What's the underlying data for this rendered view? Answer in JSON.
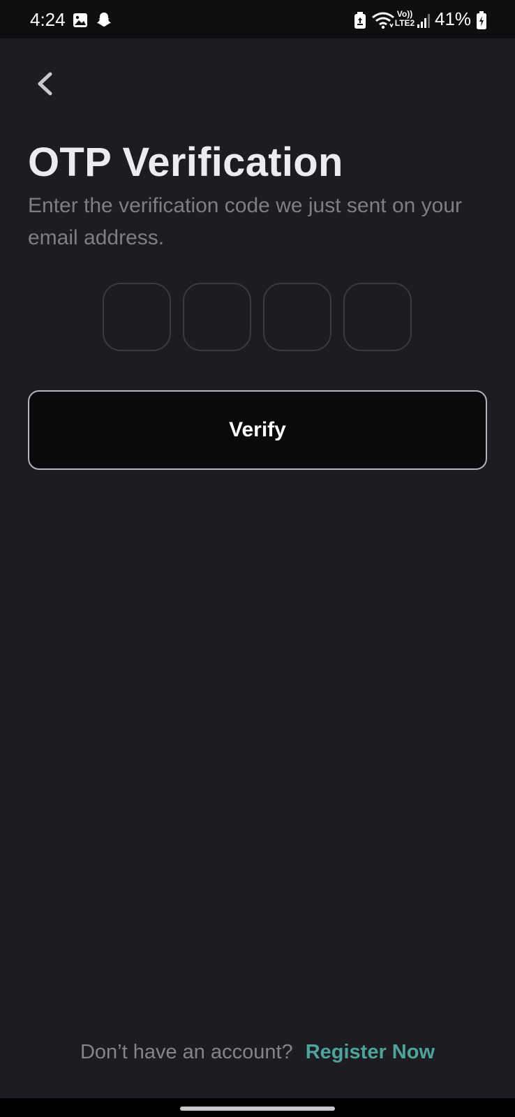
{
  "status_bar": {
    "time": "4:24",
    "network_label_top": "Vo))",
    "network_label_bottom": "LTE2",
    "battery_percent": "41%",
    "icons": [
      "gallery-icon",
      "snapchat-icon",
      "recycle-battery-icon",
      "wifi-icon",
      "signal-icon",
      "battery-icon"
    ]
  },
  "header": {
    "back_icon": "chevron-left-icon",
    "title": "OTP Verification",
    "subtitle": "Enter the verification code we just sent on your email address."
  },
  "otp": {
    "digits": [
      "",
      "",
      "",
      ""
    ]
  },
  "actions": {
    "verify_label": "Verify"
  },
  "footer": {
    "prompt": "Don’t have an account?",
    "link_label": "Register Now"
  },
  "colors": {
    "background": "#1d1c21",
    "status_bar": "#0f0f12",
    "title": "#ecebf0",
    "subtitle": "#7f7e84",
    "otp_border": "#3b3a40",
    "button_bg": "#0a0a0d",
    "button_border": "#b5b4ba",
    "link": "#4ea39d"
  }
}
